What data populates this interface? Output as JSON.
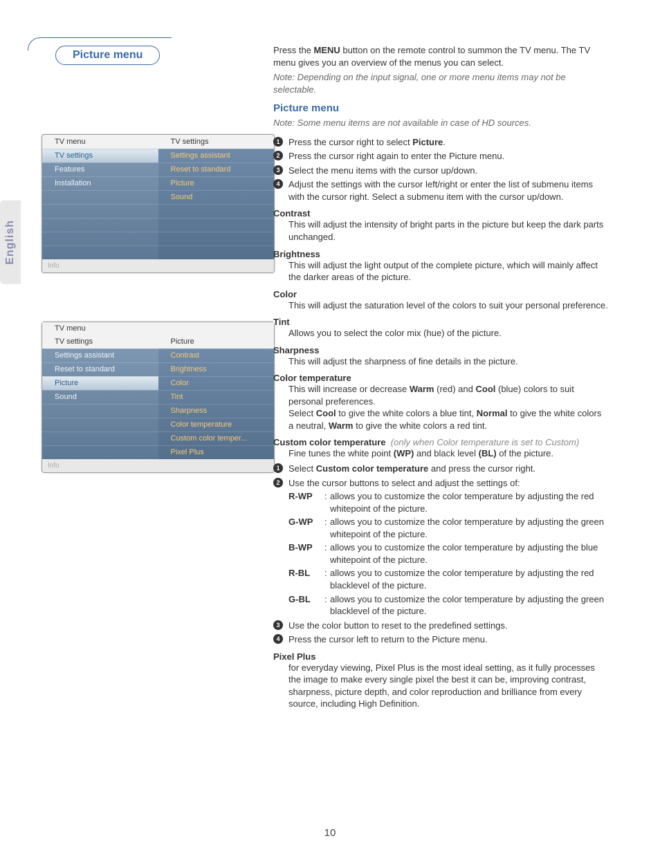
{
  "language_tab": "English",
  "section_title": "Picture menu",
  "page_number": "10",
  "intro": {
    "part1": "Press the ",
    "menu_bold": "MENU",
    "part2": " button on the remote control to summon the TV menu. The TV menu gives you an overview of the menus you can select.",
    "note": "Note: Depending on the input signal, one or more menu items may not be selectable."
  },
  "picture_menu": {
    "heading": "Picture menu",
    "note": "Note: Some menu items are not available in case of HD sources.",
    "steps": [
      {
        "n": "1",
        "pre": "Press the cursor right to select ",
        "bold": "Picture",
        "post": "."
      },
      {
        "n": "2",
        "text": "Press the cursor right again to enter the Picture menu."
      },
      {
        "n": "3",
        "text": "Select the menu items with the cursor up/down."
      },
      {
        "n": "4",
        "text": "Adjust the settings with the cursor left/right or enter the list of submenu items with the cursor right. Select a submenu item with the cursor up/down."
      }
    ]
  },
  "defs": [
    {
      "t": "Contrast",
      "b": "This will adjust the intensity of bright parts in the picture but keep the dark parts unchanged."
    },
    {
      "t": "Brightness",
      "b": "This will adjust the light output of the complete picture, which will mainly affect the darker areas of the picture."
    },
    {
      "t": "Color",
      "b": "This will adjust the saturation level of the colors to suit your personal preference."
    },
    {
      "t": "Tint",
      "b": "Allows you to select the color mix (hue) of the picture."
    },
    {
      "t": "Sharpness",
      "b": "This will adjust the sharpness of fine details in the picture."
    }
  ],
  "color_temp": {
    "t": "Color temperature",
    "l1a": "This will increase or decrease ",
    "l1b": "Warm",
    "l1c": " (red) and ",
    "l1d": "Cool",
    "l1e": " (blue) colors to suit personal preferences.",
    "l2a": "Select ",
    "l2b": "Cool",
    "l2c": " to give the white colors a blue tint, ",
    "l2d": "Normal",
    "l2e": " to give the white colors a neutral, ",
    "l2f": "Warm",
    "l2g": " to give the white colors a red tint."
  },
  "custom": {
    "t": "Custom color temperature",
    "note": "(only when Color temperature is set to Custom)",
    "intro_a": "Fine tunes the white point ",
    "intro_b": "(WP)",
    "intro_c": " and black level ",
    "intro_d": "(BL)",
    "intro_e": " of the picture.",
    "s1a": "Select ",
    "s1b": "Custom color temperature",
    "s1c": " and press the cursor right.",
    "s2": "Use the cursor buttons to select and adjust the settings of:",
    "subs": [
      {
        "k": "R-WP",
        "v": "allows you to customize the color temperature by adjusting the red whitepoint of the picture."
      },
      {
        "k": "G-WP",
        "v": "allows you to customize the color temperature by adjusting the green whitepoint of the picture."
      },
      {
        "k": "B-WP",
        "v": "allows you to customize the color temperature by adjusting the blue whitepoint of the picture."
      },
      {
        "k": "R-BL",
        "v": "allows you to customize the color temperature by adjusting the red blacklevel of the picture."
      },
      {
        "k": "G-BL",
        "v": "allows you to customize the color temperature by adjusting the green blacklevel of the picture."
      }
    ],
    "s3": "Use the color button to reset to the predefined settings.",
    "s4": "Press the cursor left to return to the Picture menu."
  },
  "pixel_plus": {
    "t": "Pixel Plus",
    "b": "for everyday viewing, Pixel Plus is the most ideal setting, as it fully processes the image to make every single pixel the best it can be, improving contrast, sharpness, picture depth, and color reproduction and brilliance from every source, including High Definition."
  },
  "menu1": {
    "breadcrumb": "",
    "h1": "TV menu",
    "h2": "TV settings",
    "left": [
      "TV settings",
      "Features",
      "Installation",
      "",
      "",
      "",
      "",
      ""
    ],
    "right": [
      "Settings assistant",
      "Reset to standard",
      "Picture",
      "Sound",
      "",
      "",
      "",
      ""
    ],
    "left_active_idx": 0,
    "right_amber": [
      0,
      1,
      2,
      3
    ],
    "footer": "Info"
  },
  "menu2": {
    "breadcrumb": "TV menu",
    "h1": "TV settings",
    "h2": "Picture",
    "left": [
      "Settings assistant",
      "Reset to standard",
      "Picture",
      "Sound",
      "",
      "",
      "",
      ""
    ],
    "right": [
      "Contrast",
      "Brightness",
      "Color",
      "Tint",
      "Sharpness",
      "Color temperature",
      "Custom color temper...",
      "Pixel Plus"
    ],
    "left_active_idx": 2,
    "right_amber": [
      0,
      1,
      2,
      3,
      4,
      5,
      6,
      7
    ],
    "footer": "Info"
  }
}
